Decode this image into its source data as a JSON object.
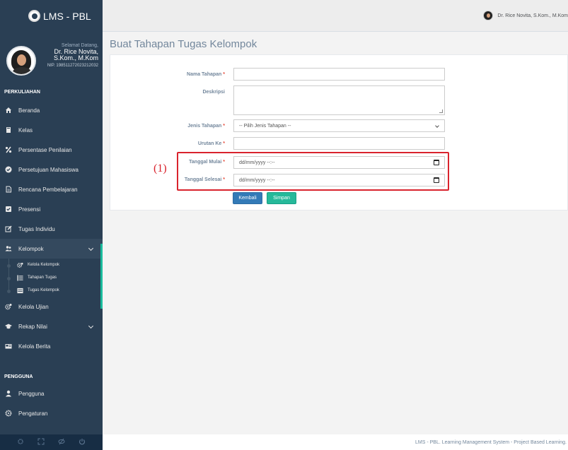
{
  "sidebar": {
    "brand": "LMS - PBL",
    "profile": {
      "welcome": "Selamat Datang,",
      "name_line1": "Dr. Rice Novita,",
      "name_line2": "S.Kom., M.Kom",
      "nip": "NIP. 198511272023212032"
    },
    "section_perkuliahan": "PERKULIAHAN",
    "items": [
      {
        "label": "Beranda",
        "icon": "home-icon"
      },
      {
        "label": "Kelas",
        "icon": "book-icon"
      },
      {
        "label": "Persentase Penilaian",
        "icon": "percent-icon"
      },
      {
        "label": "Persetujuan Mahasiswa",
        "icon": "check-circle-icon"
      },
      {
        "label": "Rencana Pembelajaran",
        "icon": "file-icon"
      },
      {
        "label": "Presensi",
        "icon": "check-square-icon"
      },
      {
        "label": "Tugas Individu",
        "icon": "edit-icon"
      },
      {
        "label": "Kelompok",
        "icon": "users-icon"
      },
      {
        "label": "Kelola Ujian",
        "icon": "cogs-icon"
      },
      {
        "label": "Rekap Nilai",
        "icon": "graduation-cap-icon"
      },
      {
        "label": "Kelola Berita",
        "icon": "newspaper-icon"
      }
    ],
    "subitems": [
      {
        "label": "Kelola Kelompok",
        "icon": "cogs-icon"
      },
      {
        "label": "Tahapan Tugas",
        "icon": "list-icon"
      },
      {
        "label": "Tugas Kelompok",
        "icon": "tasks-icon"
      }
    ],
    "section_pengguna": "PENGGUNA",
    "pengguna_items": [
      {
        "label": "Pengguna",
        "icon": "user-icon"
      },
      {
        "label": "Pengaturan",
        "icon": "gear-icon"
      }
    ]
  },
  "topnav": {
    "user_name": "Dr. Rice Novita, S.Kom., M.Kom"
  },
  "page": {
    "title": "Buat Tahapan Tugas Kelompok"
  },
  "form": {
    "nama_tahapan_label": "Nama Tahapan",
    "deskripsi_label": "Deskripsi",
    "jenis_tahapan_label": "Jenis Tahapan",
    "jenis_tahapan_value": "-- Pilih Jenis Tahapan --",
    "urutan_label": "Urutan Ke",
    "tanggal_mulai_label": "Tanggal Mulai",
    "tanggal_mulai_value": "dd/mm/yyyy --:--",
    "tanggal_selesai_label": "Tanggal Selesai",
    "tanggal_selesai_value": "dd/mm/yyyy --:--",
    "required_mark": "*",
    "back_label": "Kembali",
    "save_label": "Simpan"
  },
  "annotation": "(1)",
  "footer": "LMS - PBL. Learning Management System - Project Based Learning.",
  "colors": {
    "sidebar_bg": "#2a3f54",
    "accent_green": "#1abb9c",
    "primary_blue": "#337ab7",
    "success": "#26b99a",
    "highlight_red": "#d9232d"
  }
}
